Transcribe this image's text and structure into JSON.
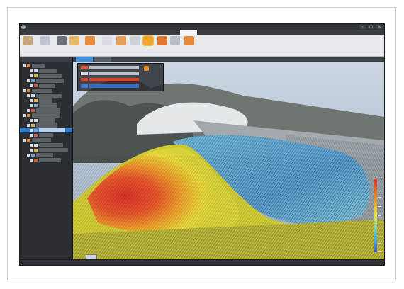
{
  "window": {
    "title": "",
    "controls": [
      "–",
      "□",
      "×"
    ]
  },
  "menu": {
    "items": [
      "",
      "",
      "",
      "",
      "",
      "",
      "",
      "",
      ""
    ],
    "active_index": 8
  },
  "ribbon": {
    "groups": [
      {
        "icon": "folder-icon"
      },
      {
        "icon": "arrow-icon"
      },
      {
        "icon": "points-icon"
      },
      {
        "icon": "measure-icon"
      },
      {
        "icon": "section-icon"
      },
      {
        "icon": "mesh-icon"
      },
      {
        "icon": "volume-icon"
      },
      {
        "icon": "grid-icon"
      },
      {
        "icon": "highlight-icon"
      },
      {
        "icon": "export-icon"
      },
      {
        "icon": "layer-icon"
      },
      {
        "icon": "settings-icon"
      }
    ],
    "highlighted_index": 8
  },
  "tree": {
    "selected_index": 13,
    "rows": 20
  },
  "viewport": {
    "tabs": 2,
    "active_tab": 0,
    "overlay_rows": [
      {
        "kind": "plain"
      },
      {
        "kind": "plain"
      },
      {
        "kind": "red"
      },
      {
        "kind": "blue"
      }
    ]
  },
  "heatmap": {
    "legend_colors": [
      "#d8322a",
      "#e78a2b",
      "#e6e23b",
      "#57c6e0",
      "#3e5fd0"
    ]
  },
  "status": {
    "text": ""
  },
  "colors": {
    "accent": "#2a7bd1",
    "highlight": "#ef8f1d"
  }
}
